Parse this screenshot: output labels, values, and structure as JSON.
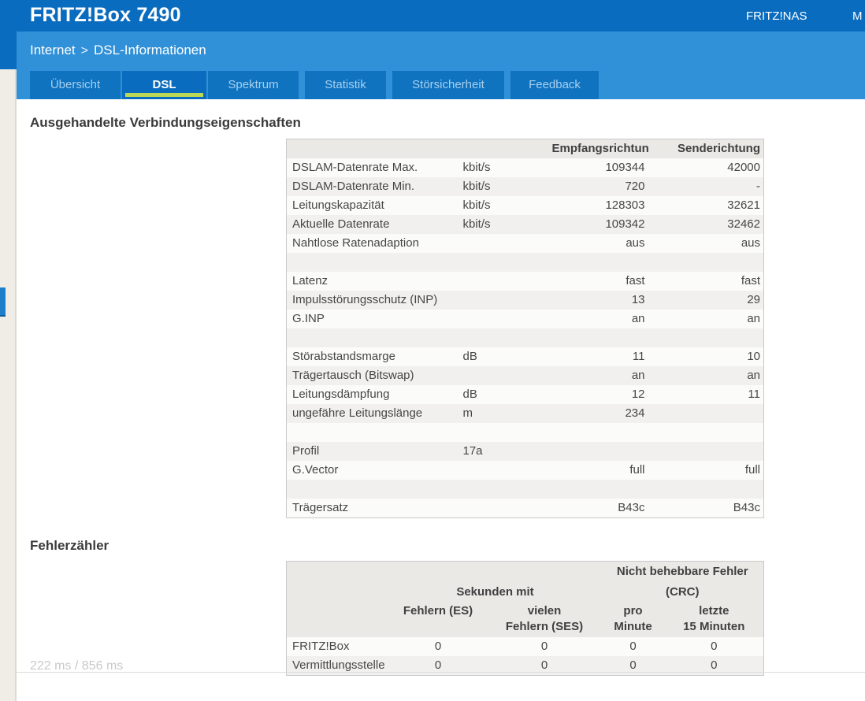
{
  "header": {
    "title": "FRITZ!Box 7490",
    "nav_fritznas": "FRITZ!NAS",
    "nav_myfritz_partial": "M"
  },
  "breadcrumb": {
    "section": "Internet",
    "separator": ">",
    "page": "DSL-Informationen"
  },
  "tabs": [
    {
      "label": "Übersicht",
      "active": false
    },
    {
      "label": "DSL",
      "active": true
    },
    {
      "label": "Spektrum",
      "active": false
    },
    {
      "label": "Statistik",
      "active": false
    },
    {
      "label": "Störsicherheit",
      "active": false
    },
    {
      "label": "Feedback",
      "active": false
    }
  ],
  "colors": {
    "header_blue": "#0a6cbe",
    "bar_blue": "#3090d8",
    "tab_blue": "#0f73c0",
    "active_tab_underline_green": "#bdd856",
    "sidebar_beige": "#efede6",
    "table_header_gray": "#eae9e6",
    "row_alt_gray": "#f1f0ee"
  },
  "connection": {
    "heading": "Ausgehandelte Verbindungseigenschaften",
    "columns": {
      "rx": "Empfangsrichtung",
      "tx": "Senderichtung"
    },
    "rows": [
      {
        "label": "DSLAM-Datenrate Max.",
        "unit": "kbit/s",
        "rx": "109344",
        "tx": "42000"
      },
      {
        "label": "DSLAM-Datenrate Min.",
        "unit": "kbit/s",
        "rx": "720",
        "tx": "-"
      },
      {
        "label": "Leitungskapazität",
        "unit": "kbit/s",
        "rx": "128303",
        "tx": "32621"
      },
      {
        "label": "Aktuelle Datenrate",
        "unit": "kbit/s",
        "rx": "109342",
        "tx": "32462"
      },
      {
        "label": "Nahtlose Ratenadaption",
        "unit": "",
        "rx": "aus",
        "tx": "aus"
      },
      {
        "label": "",
        "unit": "",
        "rx": "",
        "tx": ""
      },
      {
        "label": "Latenz",
        "unit": "",
        "rx": "fast",
        "tx": "fast"
      },
      {
        "label": "Impulsstörungsschutz (INP)",
        "unit": "",
        "rx": "13",
        "tx": "29"
      },
      {
        "label": "G.INP",
        "unit": "",
        "rx": "an",
        "tx": "an"
      },
      {
        "label": "",
        "unit": "",
        "rx": "",
        "tx": ""
      },
      {
        "label": "Störabstandsmarge",
        "unit": "dB",
        "rx": "11",
        "tx": "10"
      },
      {
        "label": "Trägertausch (Bitswap)",
        "unit": "",
        "rx": "an",
        "tx": "an"
      },
      {
        "label": "Leitungsdämpfung",
        "unit": "dB",
        "rx": "12",
        "tx": "11"
      },
      {
        "label": "ungefähre Leitungslänge",
        "unit": "m",
        "rx": "234",
        "tx": ""
      },
      {
        "label": "",
        "unit": "",
        "rx": "",
        "tx": ""
      },
      {
        "label": "Profil",
        "unit": "17a",
        "rx": "",
        "tx": ""
      },
      {
        "label": "G.Vector",
        "unit": "",
        "rx": "full",
        "tx": "full"
      },
      {
        "label": "",
        "unit": "",
        "rx": "",
        "tx": ""
      },
      {
        "label": "Trägersatz",
        "unit": "",
        "rx": "B43c",
        "tx": "B43c"
      }
    ]
  },
  "errors": {
    "heading": "Fehlerzähler",
    "group_seconds": "Sekunden mit",
    "group_crc": "Nicht behebbare Fehler (CRC)",
    "columns": [
      {
        "line1": "Fehlern (ES)",
        "line2": ""
      },
      {
        "line1": "vielen",
        "line2": "Fehlern (SES)"
      },
      {
        "line1": "pro",
        "line2": "Minute"
      },
      {
        "line1": "letzte",
        "line2": "15 Minuten"
      }
    ],
    "rows": [
      {
        "label": "FRITZ!Box",
        "values": [
          "0",
          "0",
          "0",
          "0"
        ]
      },
      {
        "label": "Vermittlungsstelle",
        "values": [
          "0",
          "0",
          "0",
          "0"
        ]
      }
    ]
  },
  "footer": {
    "timing": "222 ms / 856 ms"
  }
}
